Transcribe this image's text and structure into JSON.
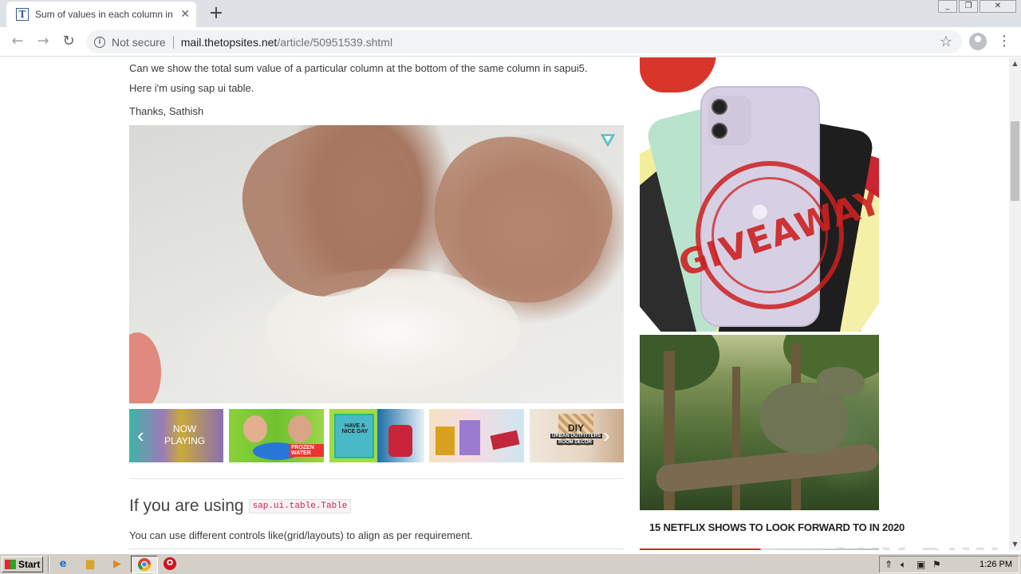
{
  "browser": {
    "tab_title": "Sum of values in each column in a table",
    "tab_favicon_letter": "T",
    "security_label": "Not secure",
    "url_host": "mail.thetopsites.net",
    "url_path": "/article/50951539.shtml"
  },
  "article": {
    "paragraph1": "Can we show the total sum value of a particular column at the bottom of the same column in sapui5.",
    "paragraph2": "Here i'm using sap ui table.",
    "signoff": "Thanks, Sathish",
    "carousel": {
      "now_playing": [
        "NOW",
        "PLAYING"
      ],
      "thumb2_caption": "FROZEN WATER",
      "thumb3_caption": "HAVE A NICE DAY",
      "thumb5_caption_1": "DIY",
      "thumb5_caption_2": "URBAN OUTFITTERS",
      "thumb5_caption_3": "ROOM DECOR"
    },
    "heading": "If you are using",
    "heading_code": "sap.ui.table.Table",
    "paragraph3": "You can use different controls like(grid/layouts) to align as per requirement."
  },
  "sidebar": {
    "ad1_stamp_text": "GIVEAWAY",
    "ad2_caption": "15 NETFLIX SHOWS TO LOOK FORWARD TO IN 2020"
  },
  "watermark": "ANY RUN",
  "taskbar": {
    "start_label": "Start",
    "clock": "1:26 PM"
  },
  "colors": {
    "stamp_red": "#cc2020",
    "link_code": "#c7254e"
  }
}
